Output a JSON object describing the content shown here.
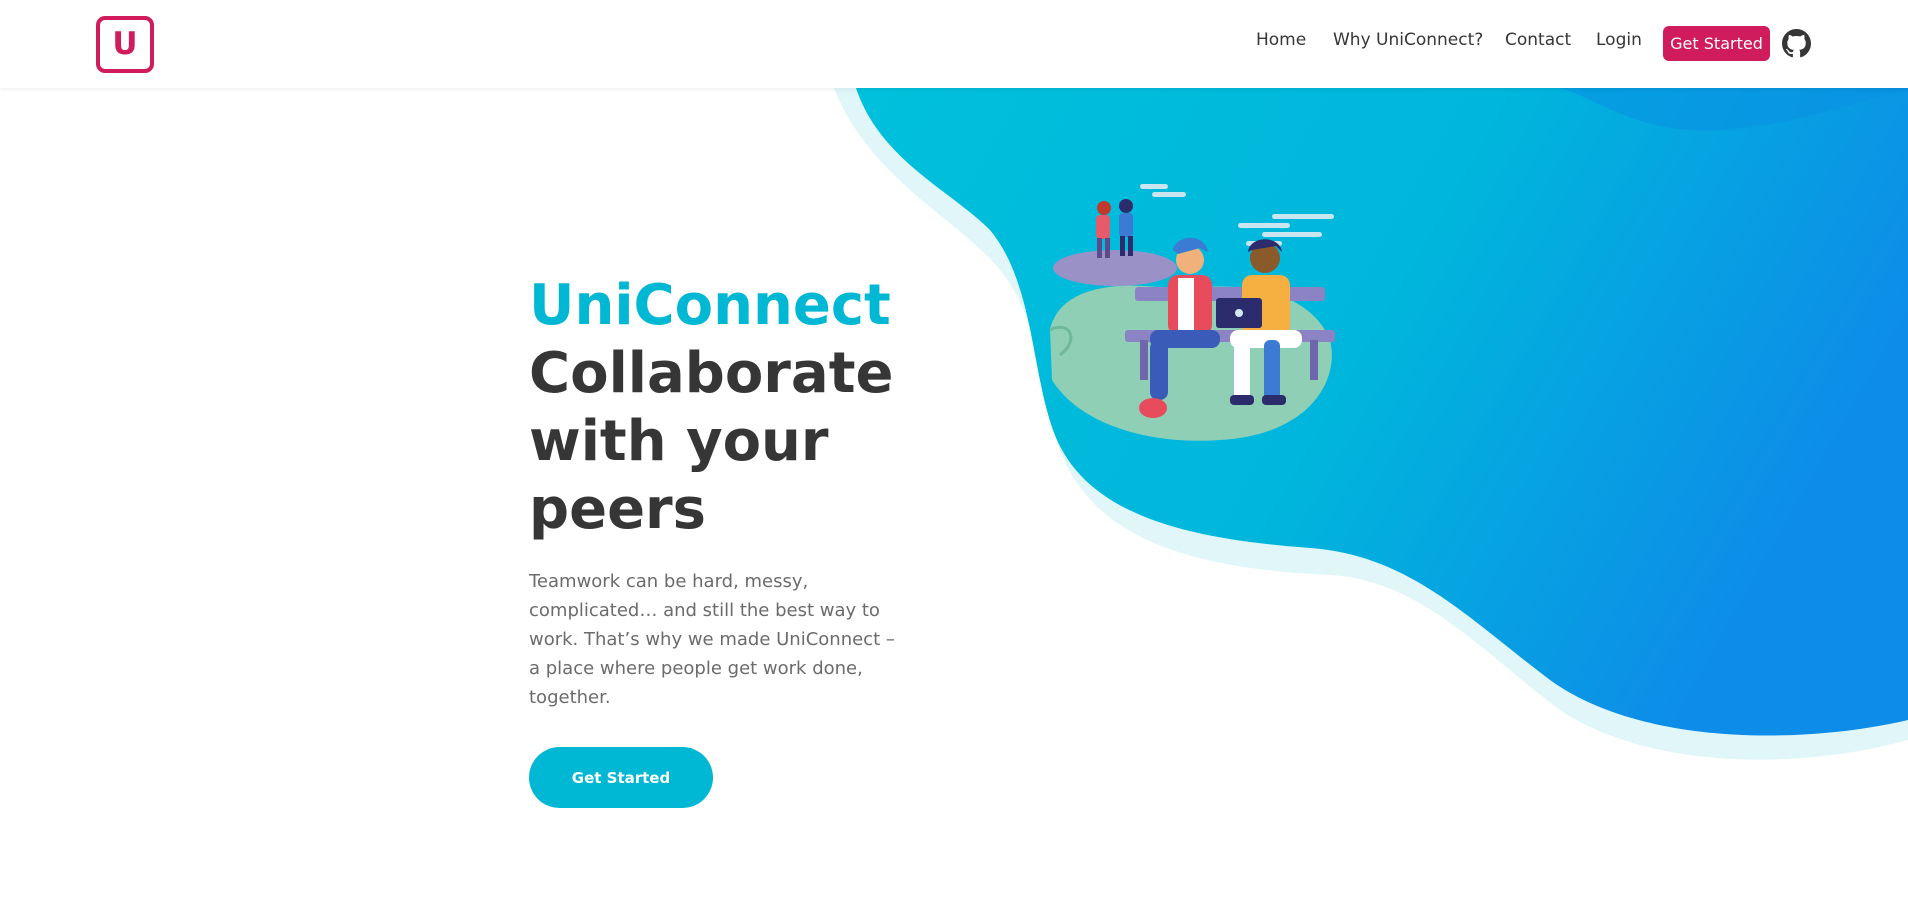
{
  "brand": {
    "logo_letter": "U",
    "accent_color": "#d01c5c",
    "primary_color": "#00b8d4"
  },
  "nav": {
    "links": [
      {
        "label": "Home"
      },
      {
        "label": "Why UniConnect?"
      },
      {
        "label": "Contact"
      },
      {
        "label": "Login"
      }
    ],
    "cta_label": "Get Started",
    "github_icon": "github-icon"
  },
  "hero": {
    "brand_name": "UniConnect",
    "tagline": "Collaborate with your peers",
    "description": "Teamwork can be hard, messy, complicated… and still the best way to work. That’s why we made UniConnect – a place where people get work done, together.",
    "cta_label": "Get Started",
    "illustration": "people-collaborating-illustration"
  }
}
